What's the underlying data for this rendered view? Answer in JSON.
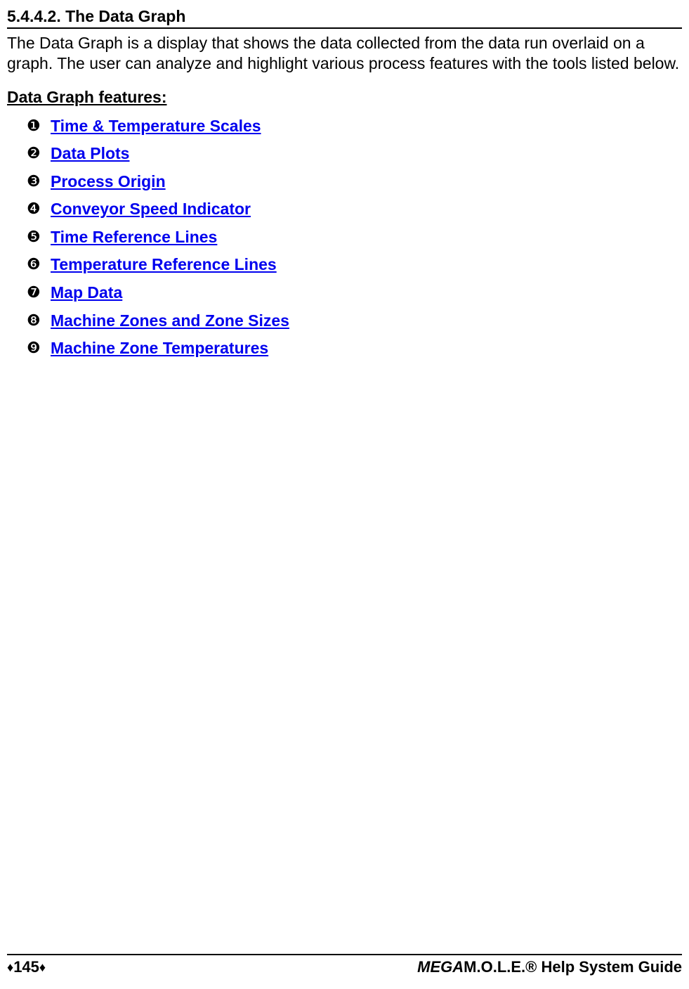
{
  "section": {
    "number": "5.4.4.2.",
    "title": "The Data Graph",
    "heading": "5.4.4.2. The Data Graph"
  },
  "body": {
    "paragraph": "The Data Graph is a display that shows the data collected from the data run overlaid on a graph. The user can analyze and highlight various process features with the tools listed below."
  },
  "features": {
    "heading": "Data Graph features:",
    "items": [
      {
        "bullet": "❶",
        "label": "Time & Temperature Scales"
      },
      {
        "bullet": "❷",
        "label": "Data Plots"
      },
      {
        "bullet": "❸",
        "label": "Process Origin"
      },
      {
        "bullet": "❹",
        "label": "Conveyor Speed Indicator"
      },
      {
        "bullet": "❺",
        "label": "Time Reference Lines"
      },
      {
        "bullet": "❻",
        "label": "Temperature Reference Lines"
      },
      {
        "bullet": "❼",
        "label": "Map Data"
      },
      {
        "bullet": "❽",
        "label": "Machine Zones and Zone Sizes"
      },
      {
        "bullet": "❾",
        "label": "Machine Zone Temperatures"
      }
    ]
  },
  "footer": {
    "page_number": "145",
    "diamond": "♦",
    "guide_prefix_italic": "MEGA",
    "guide_rest": "M.O.L.E.® Help System Guide"
  }
}
